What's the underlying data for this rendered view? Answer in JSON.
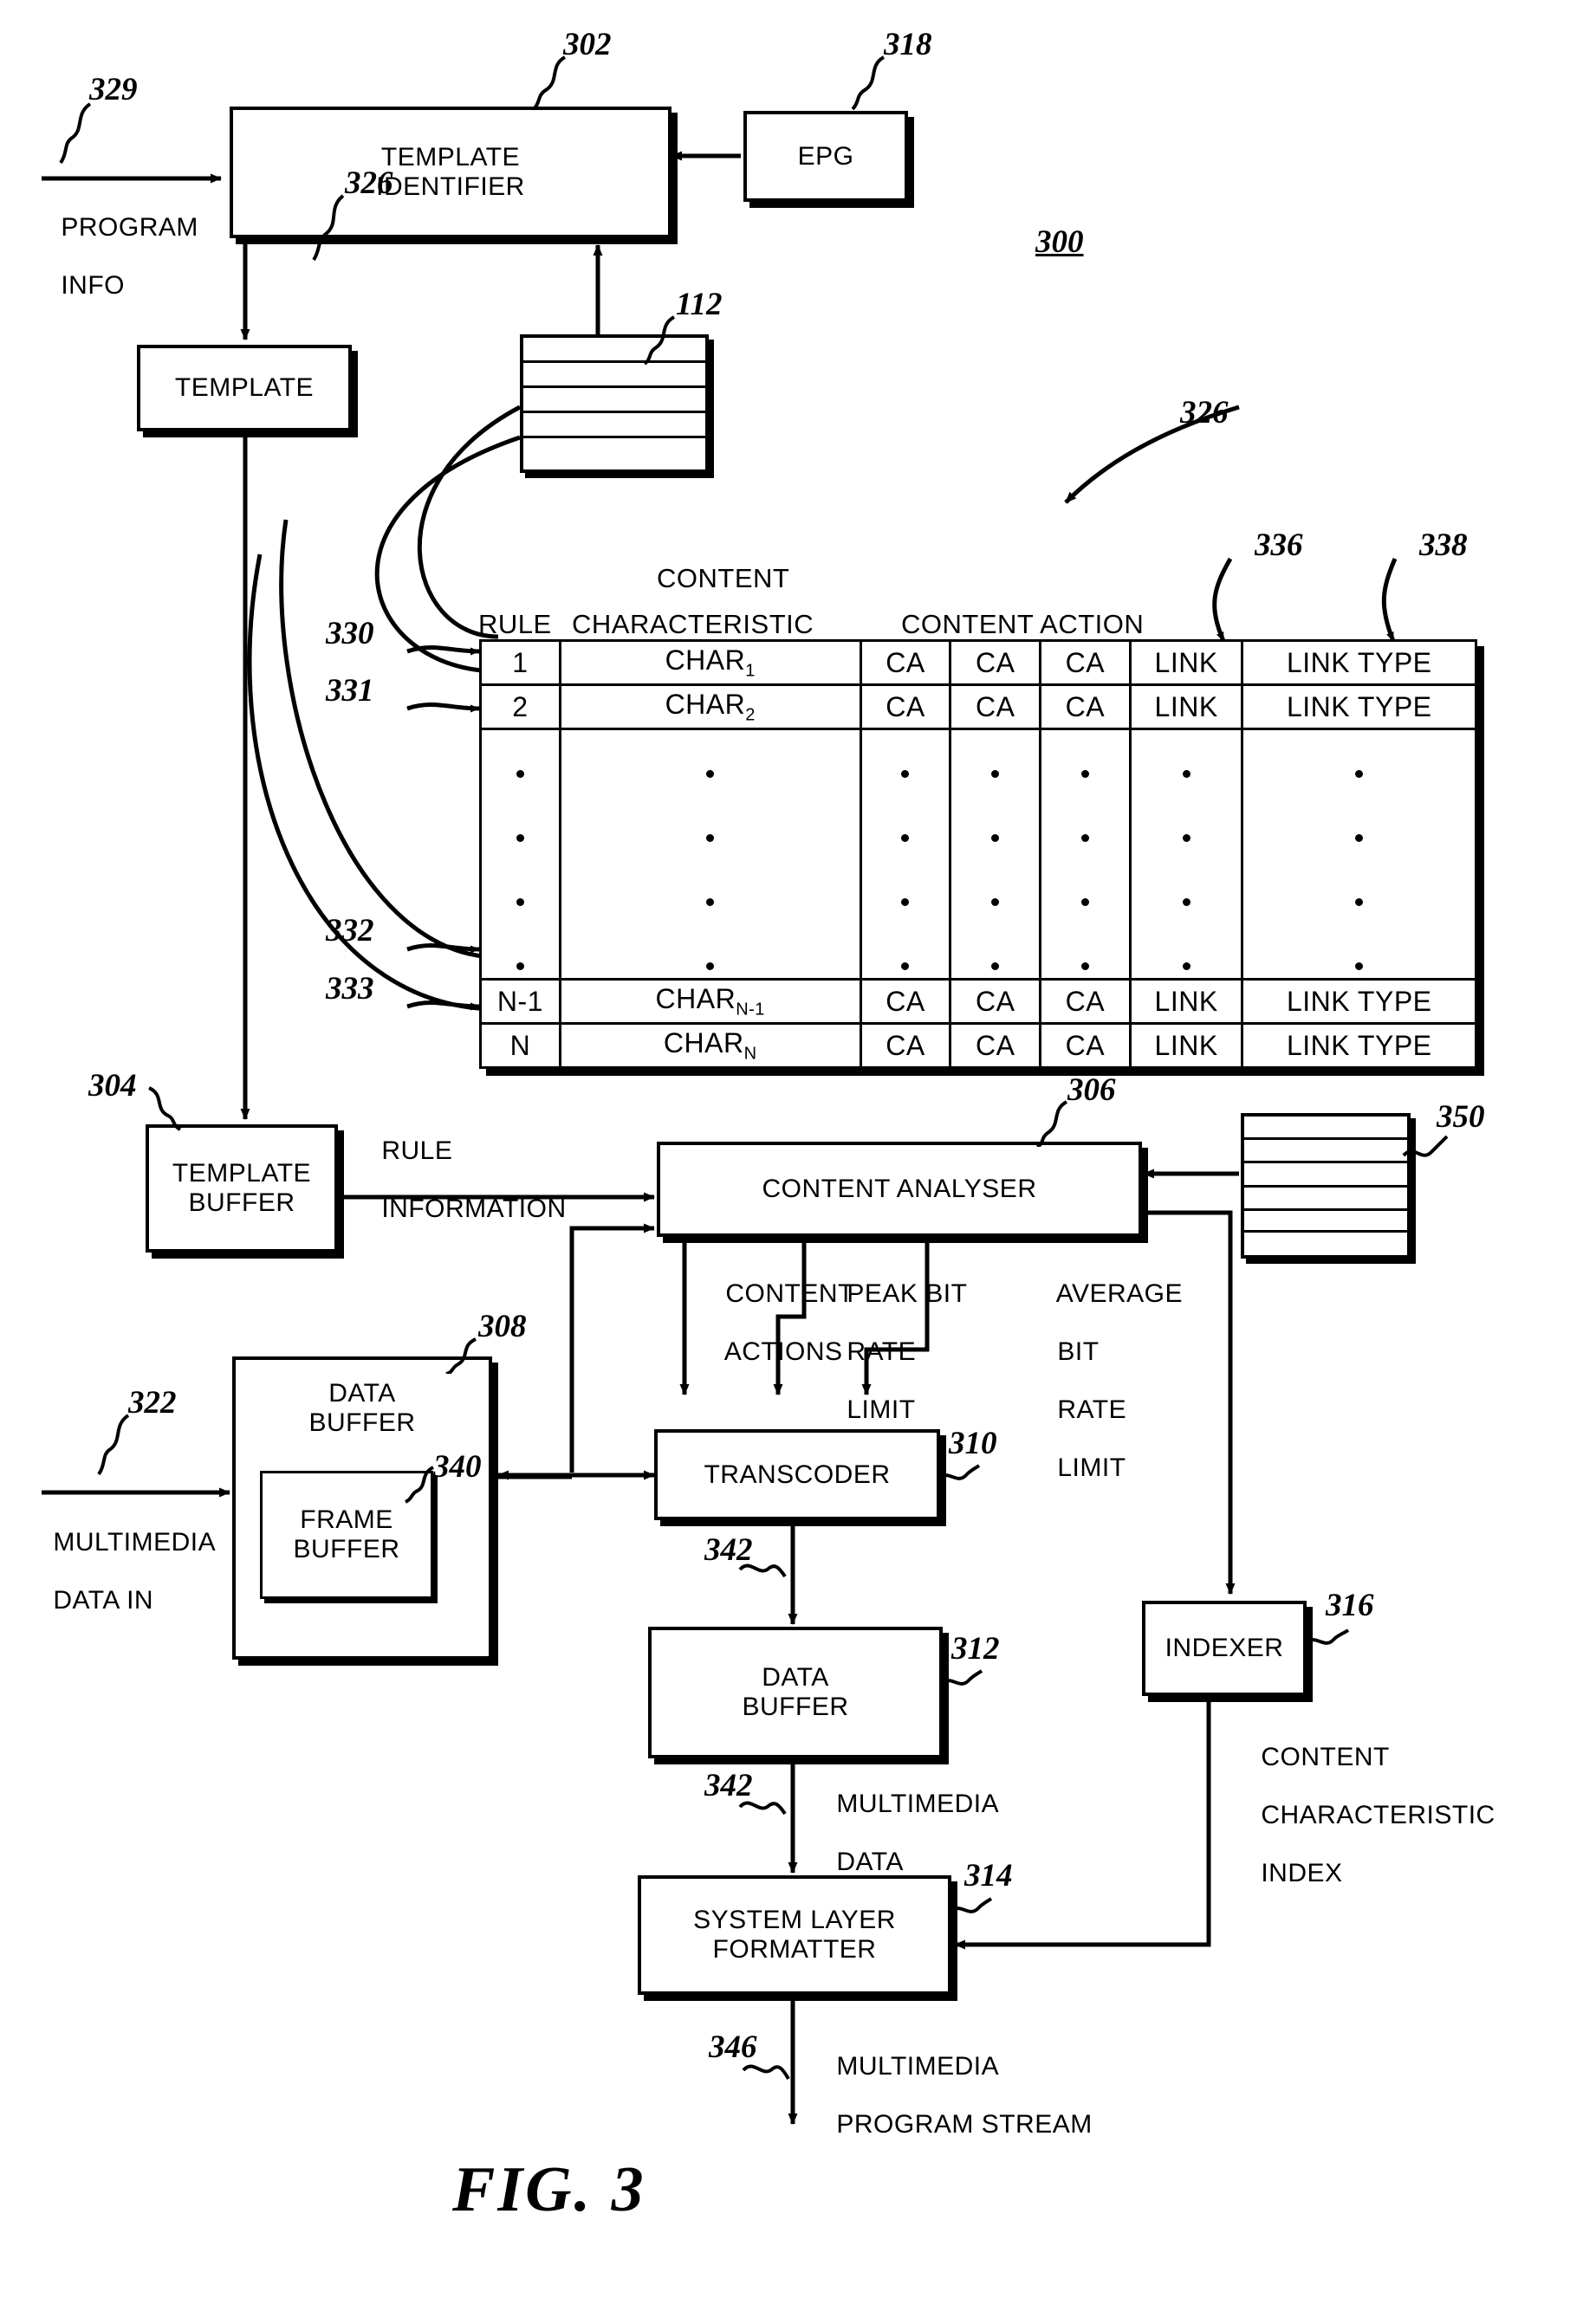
{
  "figure": {
    "caption": "FIG. 3",
    "system_ref": "300"
  },
  "blocks": {
    "template_identifier": {
      "line1": "TEMPLATE",
      "line2": "IDENTIFIER",
      "ref": "302"
    },
    "epg": {
      "line1": "EPG",
      "ref": "318"
    },
    "template": {
      "line1": "TEMPLATE",
      "ref": "326"
    },
    "template_buffer": {
      "line1": "TEMPLATE",
      "line2": "BUFFER",
      "ref": "304"
    },
    "content_analyser": {
      "line1": "CONTENT ANALYSER",
      "ref": "306"
    },
    "data_buffer_in": {
      "line1": "DATA",
      "line2": "BUFFER",
      "ref": "308"
    },
    "frame_buffer": {
      "line1": "FRAME",
      "line2": "BUFFER",
      "ref": "340"
    },
    "transcoder": {
      "line1": "TRANSCODER",
      "ref": "310"
    },
    "data_buffer_out": {
      "line1": "DATA",
      "line2": "BUFFER",
      "ref": "312"
    },
    "system_layer_formatter": {
      "line1": "SYSTEM LAYER",
      "line2": "FORMATTER",
      "ref": "314"
    },
    "indexer": {
      "line1": "INDEXER",
      "ref": "316"
    },
    "database_112": {
      "ref": "112"
    },
    "database_350": {
      "ref": "350"
    }
  },
  "signals": {
    "program_info": {
      "line1": "PROGRAM",
      "line2": "INFO",
      "ref": "329"
    },
    "multimedia_data_in": {
      "line1": "MULTIMEDIA",
      "line2": "DATA IN",
      "ref": "322"
    },
    "rule_information": {
      "line1": "RULE",
      "line2": "INFORMATION"
    },
    "content_actions": {
      "line1": "CONTENT",
      "line2": "ACTIONS"
    },
    "peak_bit_rate_limit": {
      "line1": "PEAK BIT",
      "line2": "RATE",
      "line3": "LIMIT"
    },
    "average_bit_rate_limit": {
      "line1": "AVERAGE",
      "line2": "BIT",
      "line3": "RATE",
      "line4": "LIMIT"
    },
    "transcoder_out": {
      "ref": "342"
    },
    "multimedia_data": {
      "line1": "MULTIMEDIA",
      "line2": "DATA",
      "ref": "342"
    },
    "content_characteristic_index": {
      "line1": "CONTENT",
      "line2": "CHARACTERISTIC",
      "line3": "INDEX"
    },
    "multimedia_program_stream": {
      "line1": "MULTIMEDIA",
      "line2": "PROGRAM STREAM",
      "ref": "346"
    }
  },
  "rule_table": {
    "ref": "326",
    "header_top": "CONTENT",
    "headers": [
      "RULE",
      "CHARACTERISTIC",
      "CONTENT ACTION"
    ],
    "column_refs": {
      "link": "336",
      "link_type": "338"
    },
    "row_refs": [
      "330",
      "331",
      "332",
      "333"
    ],
    "rows": [
      {
        "rule": "1",
        "char": "CHAR",
        "char_sub": "1",
        "ca": [
          "CA",
          "CA",
          "CA"
        ],
        "link": "LINK",
        "link_type": "LINK TYPE"
      },
      {
        "rule": "2",
        "char": "CHAR",
        "char_sub": "2",
        "ca": [
          "CA",
          "CA",
          "CA"
        ],
        "link": "LINK",
        "link_type": "LINK TYPE"
      },
      {
        "rule": "N-1",
        "char": "CHAR",
        "char_sub": "N-1",
        "ca": [
          "CA",
          "CA",
          "CA"
        ],
        "link": "LINK",
        "link_type": "LINK TYPE"
      },
      {
        "rule": "N",
        "char": "CHAR",
        "char_sub": "N",
        "ca": [
          "CA",
          "CA",
          "CA"
        ],
        "link": "LINK",
        "link_type": "LINK TYPE"
      }
    ],
    "ellipsis_rows": 4
  }
}
